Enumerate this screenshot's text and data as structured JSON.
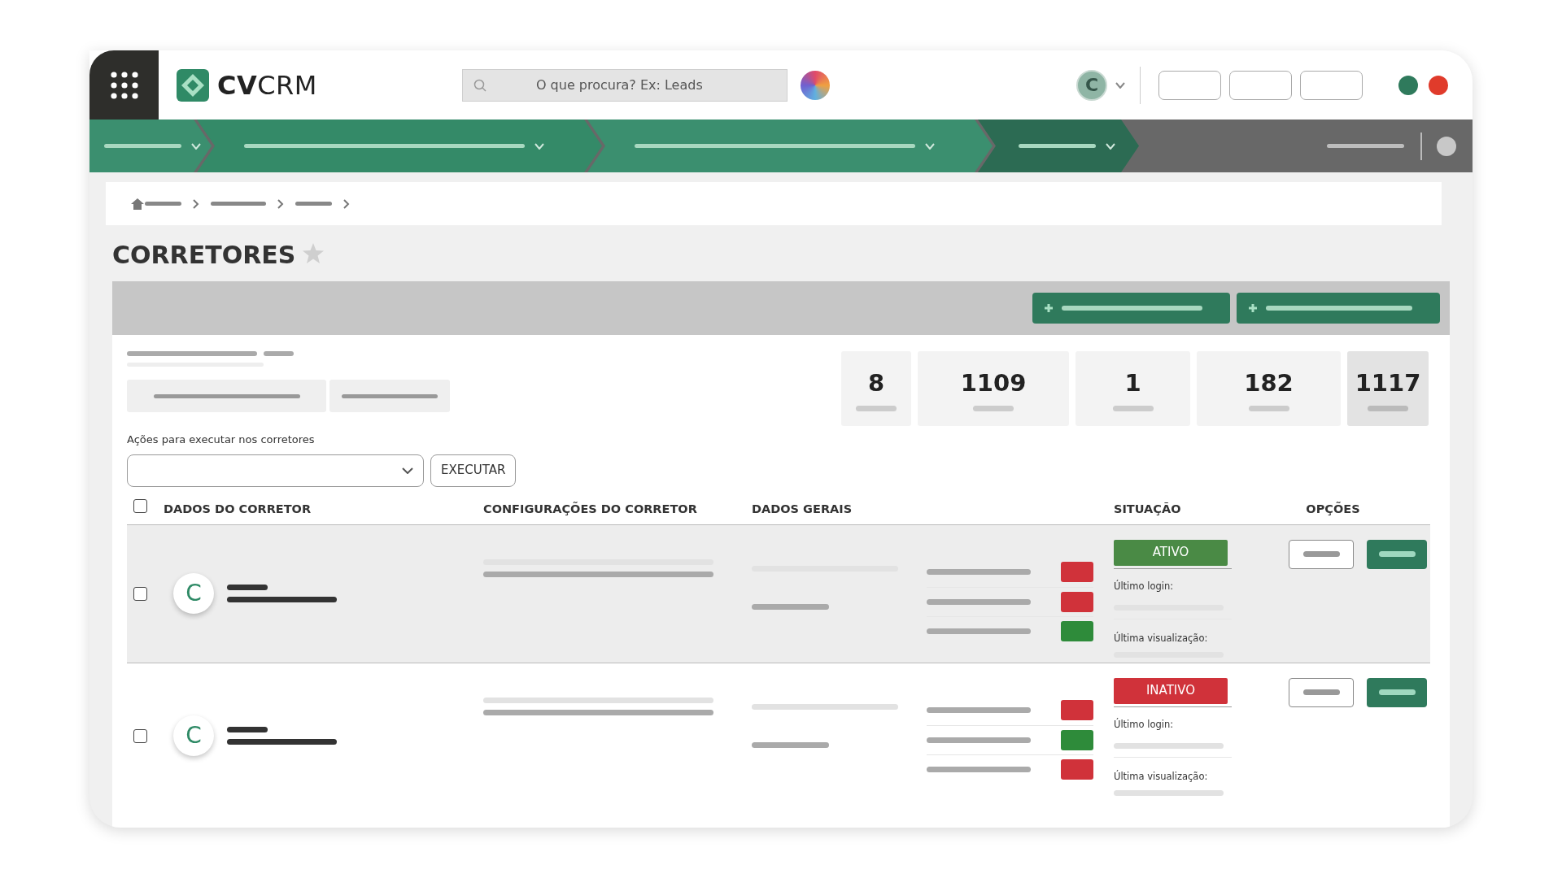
{
  "app": {
    "logo": "**CV**CRM",
    "search": {
      "placeholder": "O que procura? Ex: Leads"
    },
    "avatar": "C"
  },
  "menu": [
    {
      "selected": false
    },
    {
      "selected": false
    },
    {
      "selected": false
    },
    {
      "selected": true
    }
  ],
  "page": {
    "title": "CORRETORES",
    "favorite": false
  },
  "stats": [
    {
      "value": "8",
      "highlighted": false
    },
    {
      "value": "1109",
      "highlighted": false
    },
    {
      "value": "1",
      "highlighted": false
    },
    {
      "value": "182",
      "highlighted": false
    },
    {
      "value": "1117",
      "highlighted": true
    }
  ],
  "actions": {
    "label": "Ações para executar nos corretores",
    "button": "EXECUTAR"
  },
  "table": {
    "select_all": {
      "checked": false
    },
    "columns": [
      "DADOS DO CORRETOR",
      "CONFIGURAÇÕES DO CORRETOR",
      "DADOS GERAIS",
      "SITUAÇÃO",
      "OPÇÕES"
    ],
    "rows": [
      {
        "checked": false,
        "highlighted": true,
        "avatar": "C",
        "flags": [
          {
            "color": "#d0323a"
          },
          {
            "color": "#d0323a"
          },
          {
            "color": "#2e8b3a"
          }
        ],
        "status": {
          "kind": "active",
          "label": "ATIVO"
        },
        "last_login_label": "Último login:",
        "last_view_label": "Última visualização:"
      },
      {
        "checked": false,
        "highlighted": false,
        "avatar": "C",
        "flags": [
          {
            "color": "#d0323a"
          },
          {
            "color": "#2e8b3a"
          },
          {
            "color": "#d0323a"
          }
        ],
        "status": {
          "kind": "inactive",
          "label": "INATIVO"
        },
        "last_login_label": "Último login:",
        "last_view_label": "Última visualização:"
      }
    ]
  }
}
